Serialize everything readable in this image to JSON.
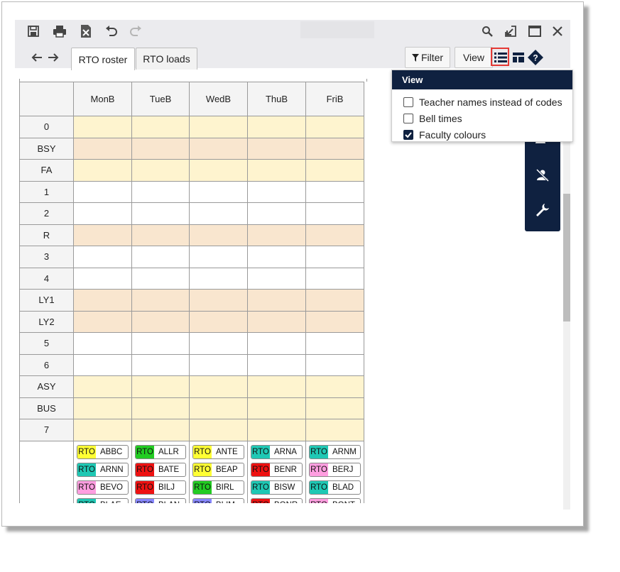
{
  "tabs": [
    {
      "label": "RTO roster",
      "active": true
    },
    {
      "label": "RTO loads",
      "active": false
    }
  ],
  "toolbar": {
    "icons_left": [
      "save-icon",
      "print-icon",
      "export-icon",
      "undo-icon",
      "redo-icon"
    ],
    "icons_right": [
      "search-icon",
      "minimize-icon",
      "maximize-icon",
      "close-icon"
    ],
    "nav": [
      "back-arrow-icon",
      "forward-arrow-icon"
    ],
    "filter_label": "Filter",
    "view_label": "View"
  },
  "grid": {
    "days": [
      "MonB",
      "TueB",
      "WedB",
      "ThuB",
      "FriB"
    ],
    "rows": [
      {
        "label": "0",
        "shade": "yellow"
      },
      {
        "label": "BSY",
        "shade": "peach"
      },
      {
        "label": "FA",
        "shade": "yellow"
      },
      {
        "label": "1",
        "shade": "white"
      },
      {
        "label": "2",
        "shade": "white"
      },
      {
        "label": "R",
        "shade": "peach"
      },
      {
        "label": "3",
        "shade": "white"
      },
      {
        "label": "4",
        "shade": "white"
      },
      {
        "label": "LY1",
        "shade": "peach"
      },
      {
        "label": "LY2",
        "shade": "peach"
      },
      {
        "label": "5",
        "shade": "white"
      },
      {
        "label": "6",
        "shade": "white"
      },
      {
        "label": "ASY",
        "shade": "yellow"
      },
      {
        "label": "BUS",
        "shade": "yellow"
      },
      {
        "label": "7",
        "shade": "yellow"
      }
    ],
    "chips": [
      [
        {
          "code": "RTO",
          "name": "ABBC",
          "color": "#ffff33"
        },
        {
          "code": "RTO",
          "name": "ARNN",
          "color": "#1fc8b4"
        },
        {
          "code": "RTO",
          "name": "BEVO",
          "color": "#ff9ee0"
        },
        {
          "code": "RTO",
          "name": "BLAE",
          "color": "#1fc8b4"
        }
      ],
      [
        {
          "code": "RTO",
          "name": "ALLR",
          "color": "#22cc22"
        },
        {
          "code": "RTO",
          "name": "BATE",
          "color": "#ee1111"
        },
        {
          "code": "RTO",
          "name": "BILJ",
          "color": "#ee1111"
        },
        {
          "code": "RTO",
          "name": "BLAN",
          "color": "#8888ff"
        }
      ],
      [
        {
          "code": "RTO",
          "name": "ANTE",
          "color": "#ffff33"
        },
        {
          "code": "RTO",
          "name": "BEAP",
          "color": "#ffff33"
        },
        {
          "code": "RTO",
          "name": "BIRL",
          "color": "#22cc22"
        },
        {
          "code": "RTO",
          "name": "BLIM",
          "color": "#8888ff"
        }
      ],
      [
        {
          "code": "RTO",
          "name": "ARNA",
          "color": "#1fc8b4"
        },
        {
          "code": "RTO",
          "name": "BENR",
          "color": "#ee1111"
        },
        {
          "code": "RTO",
          "name": "BISW",
          "color": "#1fc8b4"
        },
        {
          "code": "RTO",
          "name": "BONR",
          "color": "#ee1111"
        }
      ],
      [
        {
          "code": "RTO",
          "name": "ARNM",
          "color": "#1fc8b4"
        },
        {
          "code": "RTO",
          "name": "BERJ",
          "color": "#ff9ee0"
        },
        {
          "code": "RTO",
          "name": "BLAD",
          "color": "#1fc8b4"
        },
        {
          "code": "RTO",
          "name": "BONT",
          "color": "#ff9ee0"
        }
      ]
    ]
  },
  "view_menu": {
    "title": "View",
    "options": [
      {
        "label": "Teacher names instead of codes",
        "checked": false
      },
      {
        "label": "Bell times",
        "checked": false
      },
      {
        "label": "Faculty colours",
        "checked": true
      }
    ]
  },
  "side_panel": {
    "icons": [
      "users-icon",
      "remove-user-icon",
      "wrench-icon"
    ]
  },
  "colors": {
    "navy": "#0f2140",
    "yellow": "#fef4cf",
    "peach": "#f9e6cf",
    "highlight": "#e53935"
  }
}
